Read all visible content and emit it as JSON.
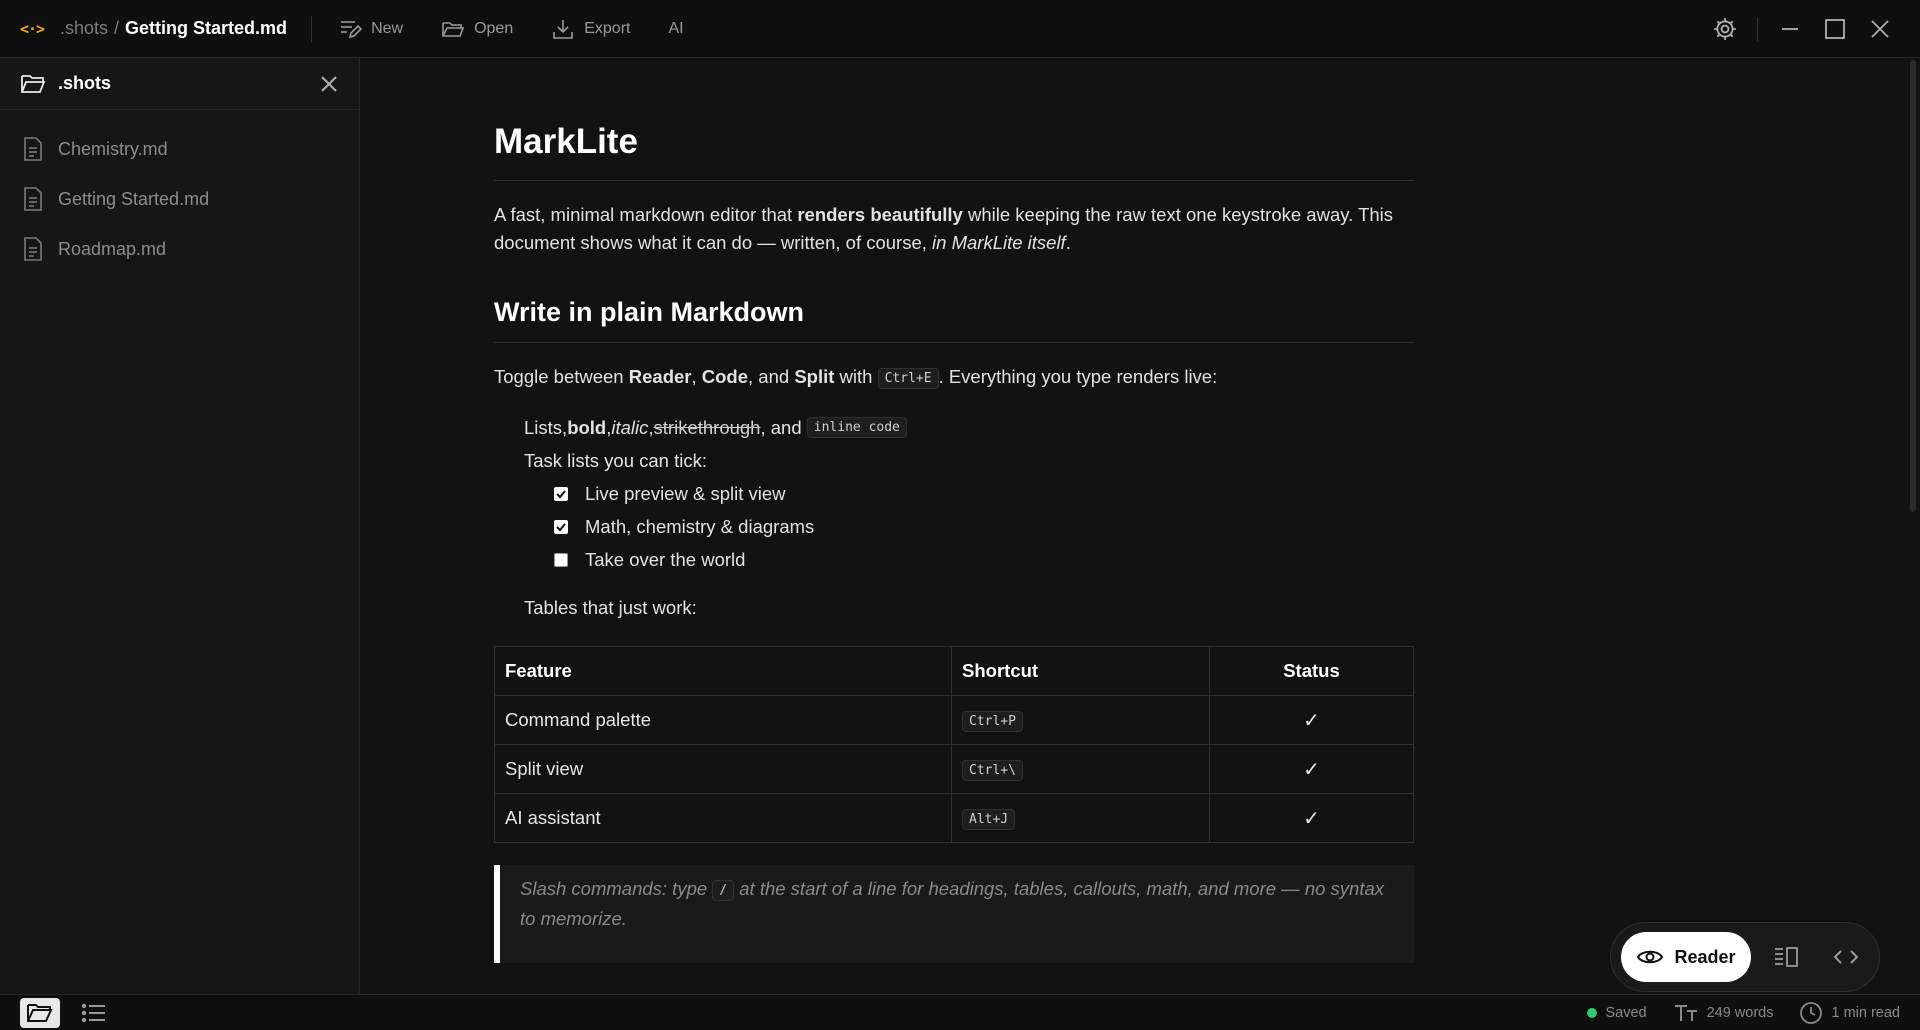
{
  "titlebar": {
    "logo_glyph": "<·>",
    "breadcrumb_folder": ".shots",
    "breadcrumb_sep": "/",
    "breadcrumb_file": "Getting Started.md",
    "toolbar": {
      "new_label": "New",
      "open_label": "Open",
      "export_label": "Export",
      "ai_label": "AI"
    }
  },
  "sidebar": {
    "folder_title": ".shots",
    "files": [
      {
        "label": "Chemistry.md"
      },
      {
        "label": "Getting Started.md"
      },
      {
        "label": "Roadmap.md"
      }
    ]
  },
  "document": {
    "title": "MarkLite",
    "intro": {
      "p1": "A fast, minimal markdown editor that ",
      "bold": "renders beautifully",
      "p2": " while keeping the raw text one keystroke away. This document shows what it can do — written, of course, ",
      "italic": "in MarkLite itself",
      "p3": "."
    },
    "heading2": "Write in plain Markdown",
    "toggle": {
      "t1": "Toggle between ",
      "reader": "Reader",
      "c1": ", ",
      "code": "Code",
      "c2": ", and ",
      "split": "Split",
      "t2": " with ",
      "kbd": "Ctrl+E",
      "t3": ". Everything you type renders live:"
    },
    "list": {
      "lists_prefix": "Lists, ",
      "bold": "bold",
      "comma1": ", ",
      "italic": "italic",
      "comma2": ", ",
      "strike": "strikethrough",
      "and": ", and ",
      "inline_code": "inline code",
      "task_intro": "Task lists you can tick:",
      "tasks": [
        {
          "label": "Live preview & split view",
          "checked": true
        },
        {
          "label": "Math, chemistry & diagrams",
          "checked": true
        },
        {
          "label": "Take over the world",
          "checked": false
        }
      ],
      "tables_label": "Tables that just work:"
    },
    "table": {
      "headers": [
        "Feature",
        "Shortcut",
        "Status"
      ],
      "rows": [
        {
          "feature": "Command palette",
          "shortcut": "Ctrl+P",
          "status": "✓"
        },
        {
          "feature": "Split view",
          "shortcut": "Ctrl+\\",
          "status": "✓"
        },
        {
          "feature": "AI assistant",
          "shortcut": "Alt+J",
          "status": "✓"
        }
      ]
    },
    "callout": {
      "c1": "Slash commands: type ",
      "kbd": "/",
      "c2": " at the start of a line for headings, tables, callouts, math, and more — no syntax to memorize."
    }
  },
  "view_switch": {
    "reader_label": "Reader",
    "active": "reader"
  },
  "statusbar": {
    "saved_label": "Saved",
    "saved_color": "#2ecc71",
    "words_label": "249 words",
    "read_label": "1 min read"
  }
}
